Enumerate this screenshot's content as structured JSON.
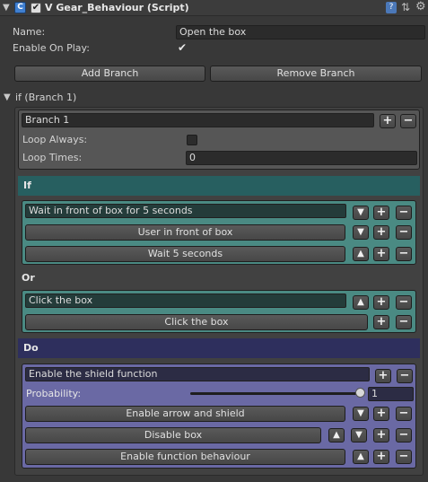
{
  "header": {
    "title": "V Gear_Behaviour (Script)",
    "enabled_check": "✔",
    "help_icon": "?",
    "preset_icon": "⇅",
    "settings_icon": "⚙"
  },
  "fields": {
    "name_label": "Name:",
    "name_value": "Open the box",
    "enable_on_play_label": "Enable On Play:",
    "enable_on_play_check": "✔"
  },
  "buttons": {
    "add_branch": "Add Branch",
    "remove_branch": "Remove Branch",
    "plus": "+",
    "minus": "−",
    "up": "▲",
    "down": "▼"
  },
  "branch": {
    "foldout_label": "if (Branch 1)",
    "name_value": "Branch 1",
    "loop_always_label": "Loop Always:",
    "loop_times_label": "Loop Times:",
    "loop_times_value": "0"
  },
  "sections": {
    "if_label": "If",
    "or_label": "Or",
    "do_label": "Do"
  },
  "if_group": {
    "title": "Wait in front of box for 5 seconds",
    "items": [
      "User in front of box",
      "Wait 5 seconds"
    ]
  },
  "or_group": {
    "title": "Click the box",
    "items": [
      "Click the box"
    ]
  },
  "do_group": {
    "title": "Enable the shield function",
    "probability_label": "Probability:",
    "probability_value": "1",
    "probability_level": 1.0,
    "items": [
      "Enable arrow and shield",
      "Disable box",
      "Enable function behaviour"
    ]
  },
  "colors": {
    "if_header": "#275f60",
    "if_panel": "#4a8a83",
    "do_header": "#2e2f5d",
    "do_panel": "#6a69a4",
    "branch_panel": "#565656"
  }
}
